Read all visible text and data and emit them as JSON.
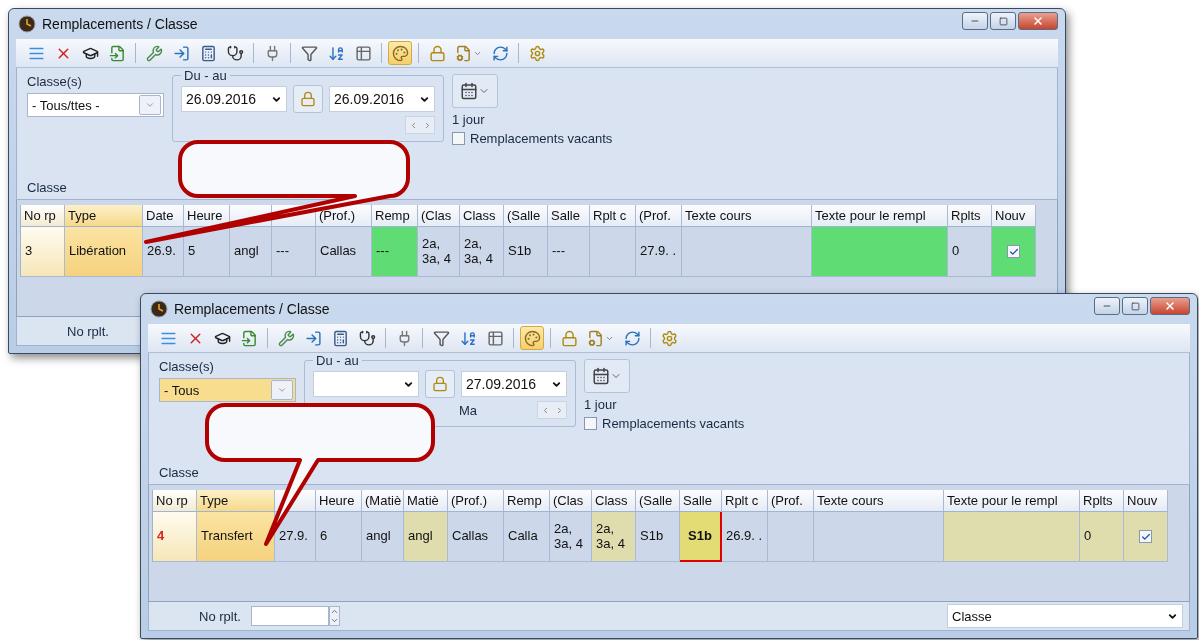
{
  "windows": [
    {
      "title": "Remplacements / Classe",
      "toolbar": [
        {
          "kind": "list",
          "pressed": false
        },
        {
          "kind": "delete",
          "pressed": false
        },
        {
          "kind": "cap",
          "pressed": false
        },
        {
          "kind": "import",
          "pressed": false
        },
        {
          "kind": "separator"
        },
        {
          "kind": "wrench",
          "pressed": false
        },
        {
          "kind": "door",
          "pressed": false
        },
        {
          "kind": "calculator",
          "pressed": false
        },
        {
          "kind": "stethoscope",
          "pressed": false
        },
        {
          "kind": "separator"
        },
        {
          "kind": "plug",
          "pressed": false
        },
        {
          "kind": "separator"
        },
        {
          "kind": "filter",
          "pressed": false
        },
        {
          "kind": "sort",
          "pressed": false
        },
        {
          "kind": "grid",
          "pressed": false
        },
        {
          "kind": "separator"
        },
        {
          "kind": "palette",
          "pressed": true
        },
        {
          "kind": "separator"
        },
        {
          "kind": "lock",
          "pressed": false
        },
        {
          "kind": "document-menu",
          "pressed": false
        },
        {
          "kind": "refresh",
          "pressed": false
        },
        {
          "kind": "separator"
        },
        {
          "kind": "gear",
          "pressed": false
        }
      ],
      "filters": {
        "classes_label": "Classe(s)",
        "classes_value": "- Tous/ttes -",
        "classes_highlighted": false,
        "range_label": "Du - au",
        "date_from": "26.09.2016",
        "date_to": "26.09.2016",
        "period": "1 jour",
        "vacant_label": "Remplacements vacants",
        "vacant_checked": false,
        "group_label": "Classe"
      },
      "table": {
        "columns": [
          {
            "label": "No rp",
            "kind": "rownum"
          },
          {
            "label": "Type",
            "kind": "type"
          },
          {
            "label": "Date",
            "kind": "data"
          },
          {
            "label": "Heure",
            "kind": "data"
          },
          {
            "kind": "data"
          },
          {
            "kind": "data"
          },
          {
            "label": "(Prof.)",
            "kind": "data"
          },
          {
            "label": "Remp",
            "kind": "data"
          },
          {
            "label": "(Clas",
            "kind": "data"
          },
          {
            "label": "Class",
            "kind": "data"
          },
          {
            "label": "(Salle",
            "kind": "data"
          },
          {
            "label": "Salle",
            "kind": "data"
          },
          {
            "label": "Rplt c",
            "kind": "data"
          },
          {
            "label": "(Prof.",
            "kind": "data"
          },
          {
            "label": "Texte cours",
            "kind": "data"
          },
          {
            "label": "Texte pour le rempl",
            "kind": "data"
          },
          {
            "label": "Rplts",
            "kind": "data"
          },
          {
            "label": "Nouv",
            "kind": "check"
          }
        ],
        "rows": [
          {
            "cells": [
              {
                "text": "3",
                "kind": "plain"
              },
              {
                "text": "Libération",
                "kind": "plain"
              },
              {
                "text": "26.9.",
                "kind": "plain"
              },
              {
                "text": "5",
                "kind": "plain"
              },
              {
                "text": "angl",
                "kind": "plain"
              },
              {
                "text": "---",
                "kind": "plain"
              },
              {
                "text": "Callas",
                "kind": "plain"
              },
              {
                "text": "---",
                "kind": "vacant"
              },
              {
                "text": "2a, 3a, 4",
                "kind": "plain"
              },
              {
                "text": "2a, 3a, 4",
                "kind": "plain"
              },
              {
                "text": "S1b",
                "kind": "plain"
              },
              {
                "text": "---",
                "kind": "plain"
              },
              {
                "kind": "plain"
              },
              {
                "text": "27.9. .",
                "kind": "plain"
              },
              {
                "kind": "plain"
              },
              {
                "kind": "vacant"
              },
              {
                "text": "0",
                "kind": "plain"
              },
              {
                "checked": true,
                "kind": "vacant"
              }
            ]
          }
        ]
      },
      "status_bar": {
        "label": "No rplt."
      }
    },
    {
      "title": "Remplacements / Classe",
      "toolbar": [
        {
          "kind": "list",
          "pressed": false
        },
        {
          "kind": "delete",
          "pressed": false
        },
        {
          "kind": "cap",
          "pressed": false
        },
        {
          "kind": "import",
          "pressed": false
        },
        {
          "kind": "separator"
        },
        {
          "kind": "wrench",
          "pressed": false
        },
        {
          "kind": "door",
          "pressed": false
        },
        {
          "kind": "calculator",
          "pressed": false
        },
        {
          "kind": "stethoscope",
          "pressed": false
        },
        {
          "kind": "separator"
        },
        {
          "kind": "plug",
          "pressed": false
        },
        {
          "kind": "separator"
        },
        {
          "kind": "filter",
          "pressed": false
        },
        {
          "kind": "sort",
          "pressed": false
        },
        {
          "kind": "grid",
          "pressed": false
        },
        {
          "kind": "separator"
        },
        {
          "kind": "palette",
          "pressed": true
        },
        {
          "kind": "separator"
        },
        {
          "kind": "lock",
          "pressed": false
        },
        {
          "kind": "document-menu",
          "pressed": false
        },
        {
          "kind": "refresh",
          "pressed": false
        },
        {
          "kind": "separator"
        },
        {
          "kind": "gear",
          "pressed": false
        }
      ],
      "filters": {
        "classes_label": "Classe(s)",
        "classes_value": "- Tous",
        "classes_highlighted": true,
        "range_label": "Du - au",
        "date_to": "27.09.2016",
        "day_label": "Ma",
        "period": "1 jour",
        "vacant_label": "Remplacements vacants",
        "vacant_checked": false,
        "group_label": "Classe"
      },
      "table": {
        "columns": [
          {
            "label": "No rp",
            "kind": "rownum"
          },
          {
            "label": "Type",
            "kind": "type"
          },
          {
            "kind": "data"
          },
          {
            "label": "Heure",
            "kind": "data"
          },
          {
            "label": "(Matiè",
            "kind": "data"
          },
          {
            "label": "Matiè",
            "kind": "data"
          },
          {
            "label": "(Prof.)",
            "kind": "data"
          },
          {
            "label": "Remp",
            "kind": "data"
          },
          {
            "label": "(Clas",
            "kind": "data"
          },
          {
            "label": "Class",
            "kind": "data"
          },
          {
            "label": "(Salle",
            "kind": "data"
          },
          {
            "label": "Salle",
            "kind": "data"
          },
          {
            "label": "Rplt c",
            "kind": "data"
          },
          {
            "label": "(Prof.",
            "kind": "data"
          },
          {
            "label": "Texte cours",
            "kind": "data"
          },
          {
            "label": "Texte pour le rempl",
            "kind": "data"
          },
          {
            "label": "Rplts",
            "kind": "data"
          },
          {
            "label": "Nouv",
            "kind": "check"
          }
        ],
        "rows": [
          {
            "cells": [
              {
                "text": "4",
                "kind": "alert"
              },
              {
                "text": "Transfert",
                "kind": "plain"
              },
              {
                "text": "27.9.",
                "kind": "plain"
              },
              {
                "text": "6",
                "kind": "plain"
              },
              {
                "text": "angl",
                "kind": "plain"
              },
              {
                "text": "angl",
                "kind": "changed"
              },
              {
                "text": "Callas",
                "kind": "plain"
              },
              {
                "text": "Calla",
                "kind": "plain"
              },
              {
                "text": "2a, 3a, 4",
                "kind": "plain"
              },
              {
                "text": "2a, 3a, 4",
                "kind": "changed"
              },
              {
                "text": "S1b",
                "kind": "plain"
              },
              {
                "text": "S1b",
                "kind": "conflict"
              },
              {
                "text": "26.9. .",
                "kind": "plain"
              },
              {
                "kind": "plain"
              },
              {
                "kind": "plain"
              },
              {
                "kind": "changed"
              },
              {
                "text": "0",
                "kind": "changed"
              },
              {
                "checked": true,
                "kind": "changed"
              }
            ]
          }
        ]
      },
      "status_bar": {
        "label": "No rplt.",
        "view": "Classe"
      }
    }
  ]
}
